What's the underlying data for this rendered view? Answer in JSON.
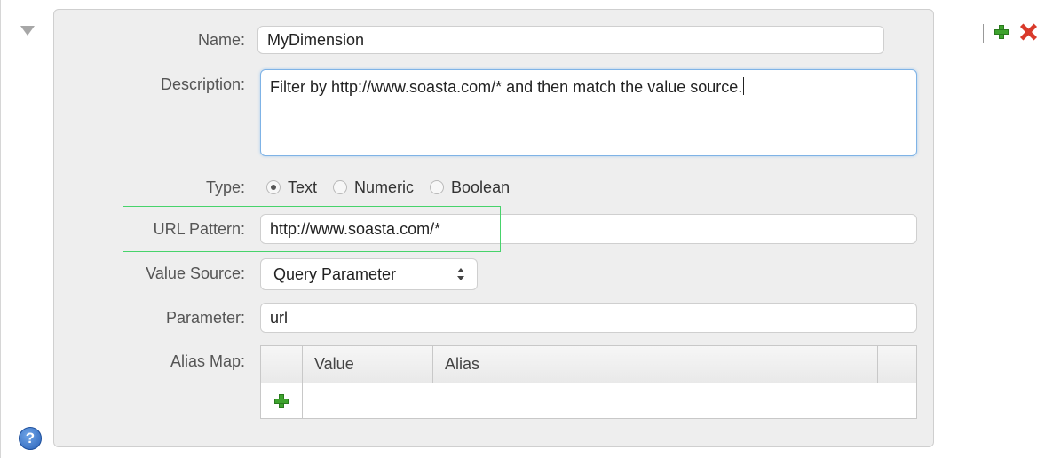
{
  "form": {
    "name": {
      "label": "Name:",
      "value": "MyDimension"
    },
    "description": {
      "label": "Description:",
      "value": "Filter by http://www.soasta.com/* and then match the value source."
    },
    "type": {
      "label": "Type:",
      "options": [
        {
          "label": "Text",
          "checked": true
        },
        {
          "label": "Numeric",
          "checked": false
        },
        {
          "label": "Boolean",
          "checked": false
        }
      ]
    },
    "url_pattern": {
      "label": "URL Pattern:",
      "value": "http://www.soasta.com/*"
    },
    "value_source": {
      "label": "Value Source:",
      "selected": "Query Parameter"
    },
    "parameter": {
      "label": "Parameter:",
      "value": "url"
    },
    "alias_map": {
      "label": "Alias Map:",
      "columns": [
        "Value",
        "Alias"
      ]
    }
  },
  "icons": {
    "collapse": "triangle-down-icon",
    "add": "plus-icon",
    "delete": "delete-x-icon",
    "help": "help-icon",
    "help_glyph": "?"
  },
  "colors": {
    "highlight": "#47d36b",
    "add_green": "#3ea32e",
    "delete_red": "#d93a2b",
    "help_blue": "#2a62b8"
  }
}
